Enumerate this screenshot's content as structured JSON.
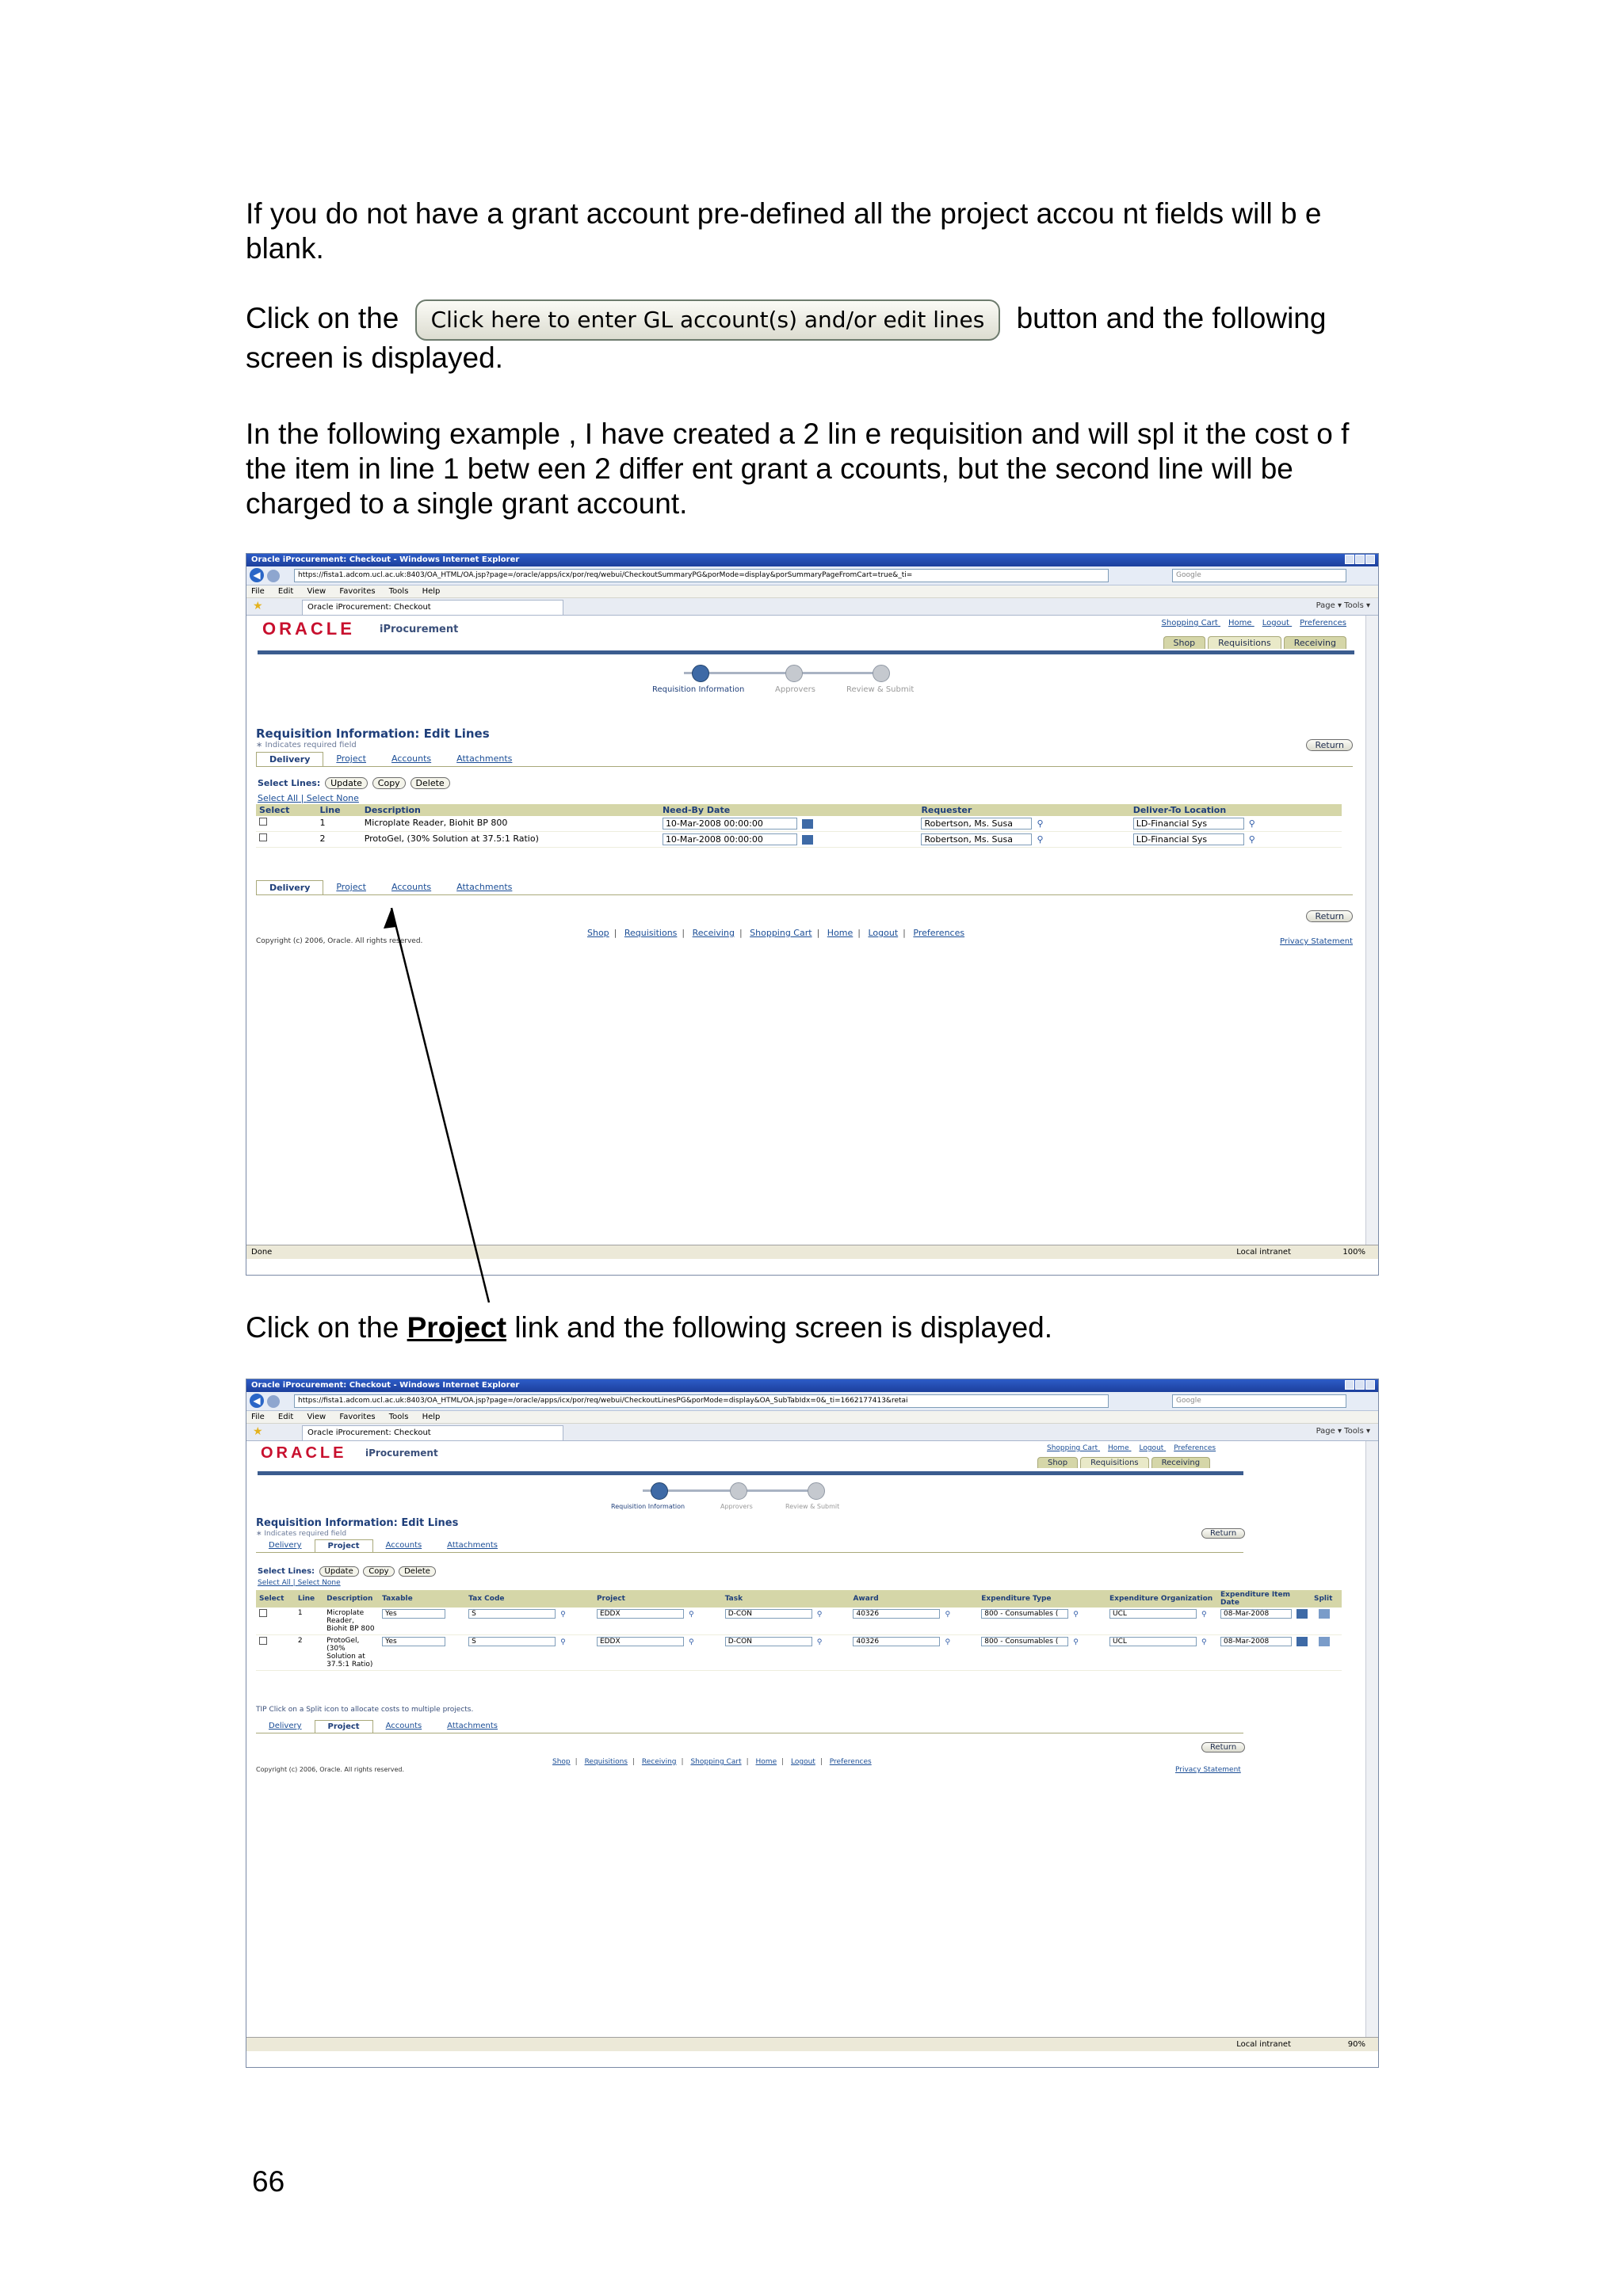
{
  "doc": {
    "para1": "If you do not have a grant account    pre-defined all the  project accou nt fields will b e blank.",
    "para2_before": "Click on the",
    "para2_button": "Click here to enter GL account(s) and/or edit lines",
    "para2_after": "button and  the following screen is displayed.",
    "para3": "In the following example , I have created a 2 lin  e requisition and will spl it the cost o f the item in    line 1 betw een 2 differ ent grant a ccounts, but  the second   line will be charged to a single grant account.",
    "para4_before": "Click on the",
    "para4_link": "Project",
    "para4_after": "link and the following screen is displayed.",
    "page_number": "66"
  },
  "browser_common": {
    "title": "Oracle iProcurement: Checkout - Windows Internet Explorer",
    "tab": "Oracle iProcurement: Checkout",
    "menu": [
      "File",
      "Edit",
      "View",
      "Favorites",
      "Tools",
      "Help"
    ],
    "search_placeholder": "Google",
    "tools_text": "Page ▾  Tools ▾",
    "zone": "Local intranet",
    "logo": "ORACLE",
    "logo_sub": "iProcurement",
    "top_links": [
      "Shopping Cart",
      "Home",
      "Logout",
      "Preferences"
    ],
    "nav_tabs": [
      "Shop",
      "Requisitions",
      "Receiving"
    ],
    "train": [
      "Requisition Information",
      "Approvers",
      "Review & Submit"
    ],
    "heading": "Requisition Information: Edit Lines",
    "required_note": "∗ Indicates required field",
    "return_label": "Return",
    "subtabs": [
      "Delivery",
      "Project",
      "Accounts",
      "Attachments"
    ],
    "select_lines_label": "Select Lines:",
    "select_buttons": [
      "Update",
      "Copy",
      "Delete"
    ],
    "select_all": "Select All",
    "select_none": "Select None",
    "footer_links": [
      "Shop",
      "Requisitions",
      "Receiving",
      "Shopping Cart",
      "Home",
      "Logout",
      "Preferences"
    ],
    "copyright": "Copyright (c) 2006, Oracle. All rights reserved.",
    "privacy": "Privacy Statement"
  },
  "shot1": {
    "url": "https://fista1.adcom.ucl.ac.uk:8403/OA_HTML/OA.jsp?page=/oracle/apps/icx/por/req/webui/CheckoutSummaryPG&porMode=display&porSummaryPageFromCart=true&_ti=",
    "status_left": "Done",
    "zoom": "100%",
    "columns": [
      "Select",
      "Line",
      "Description",
      "Need-By Date",
      "Requester",
      "Deliver-To Location"
    ],
    "rows": [
      {
        "line": "1",
        "description": "Microplate Reader, Biohit BP 800",
        "need_by": "10-Mar-2008 00:00:00",
        "requester": "Robertson, Ms. Susa",
        "location": "LD-Financial Sys"
      },
      {
        "line": "2",
        "description": "ProtoGel, (30% Solution at 37.5:1 Ratio)",
        "need_by": "10-Mar-2008 00:00:00",
        "requester": "Robertson, Ms. Susa",
        "location": "LD-Financial Sys"
      }
    ]
  },
  "shot2": {
    "url": "https://fista1.adcom.ucl.ac.uk:8403/OA_HTML/OA.jsp?page=/oracle/apps/icx/por/req/webui/CheckoutLinesPG&porMode=display&OA_SubTabIdx=0&_ti=1662177413&retai",
    "status_left": "",
    "zoom": "90%",
    "columns": [
      "Select",
      "Line",
      "Description",
      "Taxable",
      "Tax Code",
      "Project",
      "Task",
      "Award",
      "Expenditure Type",
      "Expenditure Organization",
      "Expenditure Item Date",
      "Split"
    ],
    "rows": [
      {
        "line": "1",
        "description": "Microplate Reader, Biohit BP 800",
        "taxable": "Yes",
        "tax_code": "S",
        "project": "EDDX",
        "task": "D-CON",
        "award": "40326",
        "exp_type": "800 - Consumables (",
        "exp_org": "UCL",
        "exp_date": "08-Mar-2008"
      },
      {
        "line": "2",
        "description": "ProtoGel, (30% Solution at 37.5:1 Ratio)",
        "taxable": "Yes",
        "tax_code": "S",
        "project": "EDDX",
        "task": "D-CON",
        "award": "40326",
        "exp_type": "800 - Consumables (",
        "exp_org": "UCL",
        "exp_date": "08-Mar-2008"
      }
    ],
    "tip": "TIP  Click on a Split icon to allocate costs to multiple projects."
  }
}
